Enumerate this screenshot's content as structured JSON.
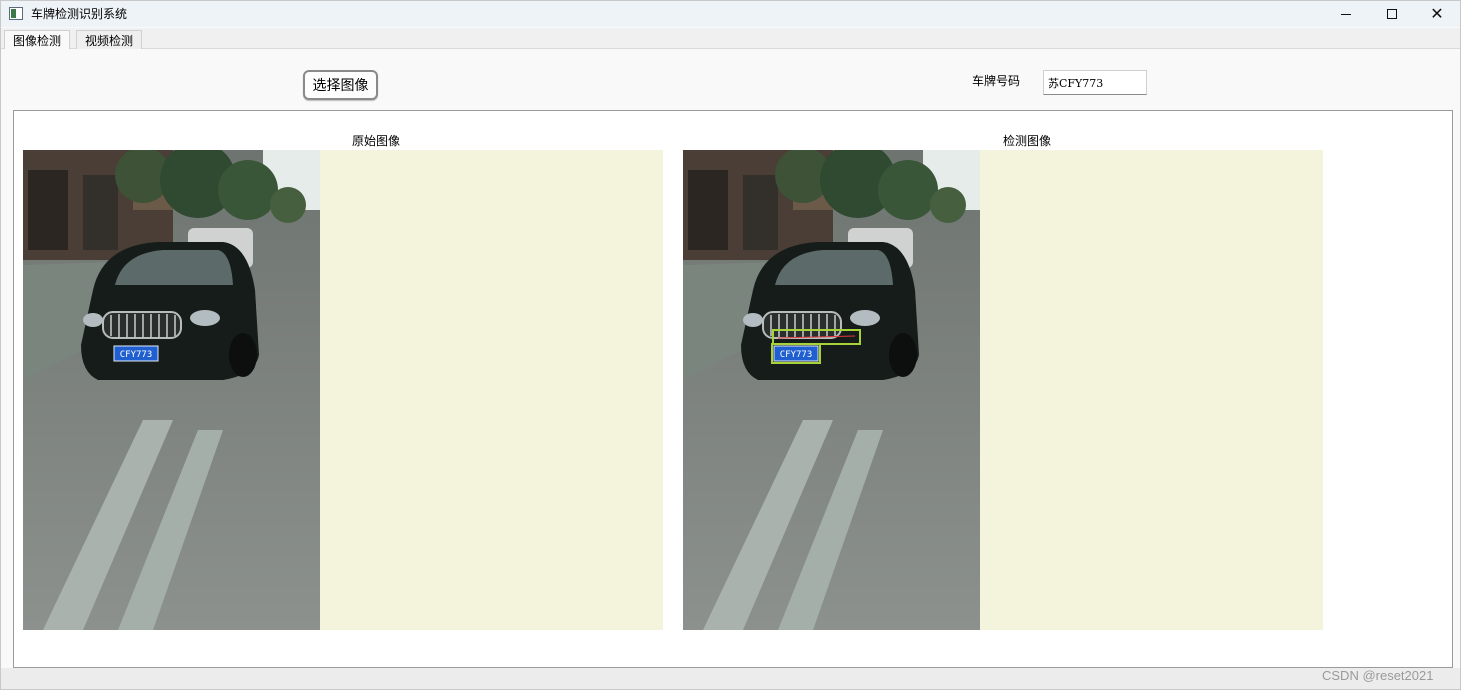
{
  "window": {
    "title": "车牌检测识别系统",
    "controls": {
      "minimize": "minimize-icon",
      "maximize": "maximize-icon",
      "close": "close-icon"
    }
  },
  "tabs": [
    {
      "label": "图像检测",
      "active": true
    },
    {
      "label": "视频检测",
      "active": false
    }
  ],
  "toolbar": {
    "select_image_label": "选择图像",
    "plate_label": "车牌号码",
    "plate_value": "苏CFY773"
  },
  "panels": {
    "original_caption": "原始图像",
    "detected_caption": "检测图像",
    "plate_text_in_photo": "CFY773",
    "background_color": "#f4f4dc"
  },
  "watermark": "CSDN @reset2021"
}
